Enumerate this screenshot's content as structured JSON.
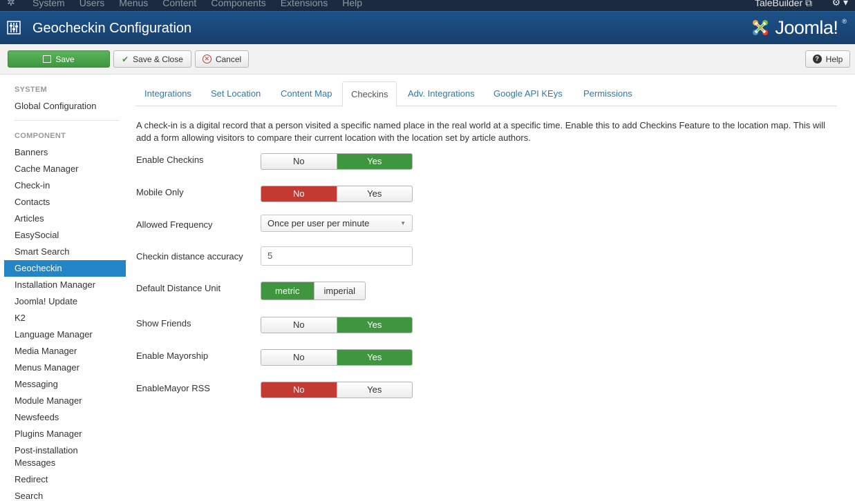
{
  "topbar": {
    "menu": [
      "System",
      "Users",
      "Menus",
      "Content",
      "Components",
      "Extensions",
      "Help"
    ],
    "user": "TaleBuilder ⧉"
  },
  "header": {
    "title": "Geocheckin Configuration",
    "logo_text": "Joomla!",
    "logo_reg": "®"
  },
  "toolbar": {
    "save": "Save",
    "save_close": "Save & Close",
    "cancel": "Cancel",
    "help": "Help"
  },
  "sidebar": {
    "system_heading": "SYSTEM",
    "global_config": "Global Configuration",
    "component_heading": "COMPONENT",
    "items": [
      "Banners",
      "Cache Manager",
      "Check-in",
      "Contacts",
      "Articles",
      "EasySocial",
      "Smart Search",
      "Geocheckin",
      "Installation Manager",
      "Joomla! Update",
      "K2",
      "Language Manager",
      "Media Manager",
      "Menus Manager",
      "Messaging",
      "Module Manager",
      "Newsfeeds",
      "Plugins Manager",
      "Post-installation Messages",
      "Redirect",
      "Search"
    ],
    "active": "Geocheckin"
  },
  "tabs": [
    "Integrations",
    "Set Location",
    "Content Map",
    "Checkins",
    "Adv. Integrations",
    "Google API KEys",
    "Permissions"
  ],
  "active_tab": "Checkins",
  "description": "A check-in is a digital record that a person visited a specific named place in the real world at a specific time. Enable this to add Checkins Feature to the location map. This will add a form allowing visitors to compare their current location with the location set by article authors.",
  "fields": {
    "enable_checkins": {
      "label": "Enable Checkins",
      "no": "No",
      "yes": "Yes",
      "value": "Yes"
    },
    "mobile_only": {
      "label": "Mobile Only",
      "no": "No",
      "yes": "Yes",
      "value": "No"
    },
    "allowed_frequency": {
      "label": "Allowed Frequency",
      "value": "Once per user per minute"
    },
    "distance_accuracy": {
      "label": "Checkin distance accuracy",
      "value": "5"
    },
    "distance_unit": {
      "label": "Default Distance Unit",
      "metric": "metric",
      "imperial": "imperial",
      "value": "metric"
    },
    "show_friends": {
      "label": "Show Friends",
      "no": "No",
      "yes": "Yes",
      "value": "Yes"
    },
    "enable_mayorship": {
      "label": "Enable Mayorship",
      "no": "No",
      "yes": "Yes",
      "value": "Yes"
    },
    "enable_mayor_rss": {
      "label": "EnableMayor RSS",
      "no": "No",
      "yes": "Yes",
      "value": "No"
    }
  },
  "colors": {
    "header_blue": "#1d5289",
    "green": "#3f963f",
    "red": "#c23a31",
    "active_blue": "#2384c6",
    "link_blue": "#2a7ab8"
  }
}
